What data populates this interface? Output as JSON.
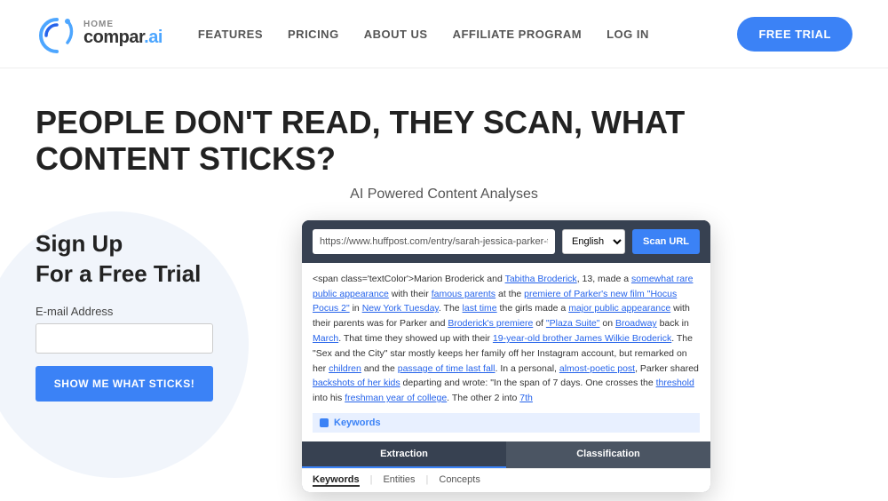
{
  "header": {
    "logo_name": "compar.ai",
    "logo_part1": "compar",
    "logo_part2": ".ai",
    "home_label": "HOME",
    "nav_items": [
      {
        "id": "features",
        "label": "FEATURES"
      },
      {
        "id": "pricing",
        "label": "PRICING"
      },
      {
        "id": "about",
        "label": "ABOUT US"
      },
      {
        "id": "affiliate",
        "label": "AFFILIATE PROGRAM"
      },
      {
        "id": "login",
        "label": "LOG IN"
      }
    ],
    "cta_button": "FREE TRIAL"
  },
  "hero": {
    "headline": "PEOPLE DON'T READ, THEY SCAN, WHAT CONTENT STICKS?",
    "subheadline": "AI Powered Content Analyses"
  },
  "signup": {
    "title_line1": "Sign Up",
    "title_line2": "For a Free Trial",
    "email_label": "E-mail Address",
    "email_placeholder": "",
    "button_label": "SHOW ME WHAT STICKS!"
  },
  "app_demo": {
    "url_value": "https://www.huffpost.com/entry/sarah-jessica-parker-t",
    "language": "English",
    "scan_button": "Scan URL",
    "article_text_preview": "Marion Broderick and Tabitha Broderick, 13, made a somewhat rare public appearance with their famous parents at the premiere of Parker's new film \"Hocus Pocus 2\" in New York Tuesday. The last time the girls made a major public appearance with their parents was for Parker and Broderick's premiere of \"Plaza Suite\" on Broadway back in March. That time they showed up with their 19-year-old brother James Wilkie Broderick. The \"Sex and the City\" star mostly keeps her family off her Instagram account, but remarked on her children and the passage of time last fall. In a personal, almost-poetic post, Parker shared backshots of her kids departing and wrote: \"In the span of 7 days. One crosses the threshold into his freshman year of college. The other 2 into 7th",
    "keywords_label": "Keywords",
    "tabs": [
      {
        "id": "extraction",
        "label": "Extraction",
        "active": true
      },
      {
        "id": "classification",
        "label": "Classification",
        "active": false
      }
    ],
    "sub_tabs": [
      {
        "id": "keywords",
        "label": "Keywords",
        "active": true
      },
      {
        "id": "entities",
        "label": "Entities",
        "active": false
      },
      {
        "id": "concepts",
        "label": "Concepts",
        "active": false
      }
    ]
  },
  "colors": {
    "primary_blue": "#3b82f6",
    "nav_text": "#555555",
    "background": "#ffffff"
  }
}
